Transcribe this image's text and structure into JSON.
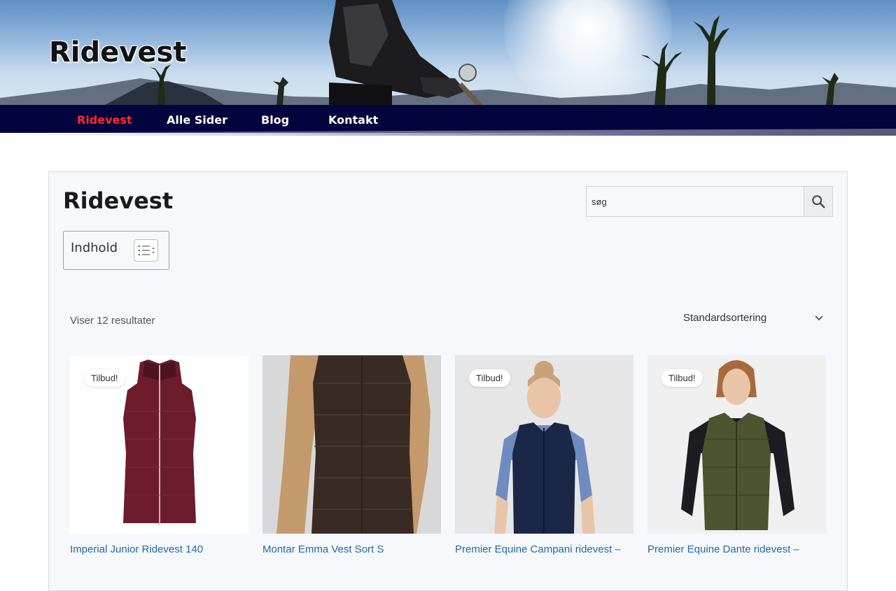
{
  "site": {
    "title": "Ridevest"
  },
  "nav": {
    "items": [
      {
        "label": "Ridevest",
        "active": true
      },
      {
        "label": "Alle Sider",
        "active": false
      },
      {
        "label": "Blog",
        "active": false
      },
      {
        "label": "Kontakt",
        "active": false
      }
    ]
  },
  "page": {
    "title": "Ridevest"
  },
  "search": {
    "placeholder": "søg",
    "icon": "search-icon"
  },
  "toc": {
    "label": "Indhold",
    "icon": "list-toggle-icon"
  },
  "shop": {
    "results_count": "Viser 12 resultater",
    "sort_selected": "Standardsortering",
    "products": [
      {
        "name": "Imperial Junior Ridevest 140",
        "badge": "Tilbud!",
        "color": "#6d1c2c"
      },
      {
        "name": "Montar Emma Vest Sort S",
        "badge": "",
        "color": "#3a2a24"
      },
      {
        "name": "Premier Equine Campani ridevest –",
        "badge": "Tilbud!",
        "color": "#1b2747"
      },
      {
        "name": "Premier Equine Dante ridevest –",
        "badge": "Tilbud!",
        "color": "#4d5430"
      }
    ]
  },
  "colors": {
    "nav_bg": "#03033d",
    "nav_active": "#ff2a2a",
    "link": "#1e6aa8"
  }
}
